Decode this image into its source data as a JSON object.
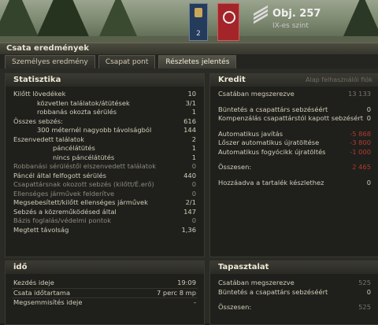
{
  "header": {
    "badge_blue_number": "2",
    "tank_name": "Obj. 257",
    "tank_tier": "IX-es szint"
  },
  "window": {
    "title": "Csata eredmények",
    "tabs": [
      "Személyes eredmény",
      "Csapat pont",
      "Részletes jelentés"
    ],
    "active_tab": 2
  },
  "stats": {
    "title": "Statisztika",
    "rows": [
      {
        "label": "Kilőtt lövedékek",
        "value": "10",
        "indent": 0
      },
      {
        "label": "közvetlen találatok/átütések",
        "value": "3/1",
        "indent": 1
      },
      {
        "label": "robbanás okozta sérülés",
        "value": "1",
        "indent": 1
      },
      {
        "label": "Összes sebzés:",
        "value": "616",
        "indent": 0
      },
      {
        "label": "300 méternél nagyobb távolságból",
        "value": "144",
        "indent": 1
      },
      {
        "label": "Eszenvedett találatok",
        "value": "2",
        "indent": 0
      },
      {
        "label": "páncélátütés",
        "value": "1",
        "indent": 2
      },
      {
        "label": "nincs páncélátütés",
        "value": "1",
        "indent": 2
      },
      {
        "label": "Robbanási sérüléstől elszenvedett találatok",
        "value": "0",
        "indent": 0,
        "dim": true
      },
      {
        "label": "Páncél által felfogott sérülés",
        "value": "440",
        "indent": 0
      },
      {
        "label": "Csapattársnak okozott sebzés (kilőtt/É.erő)",
        "value": "0",
        "indent": 0,
        "dim": true
      },
      {
        "label": "Ellenséges járművek felderítve",
        "value": "0",
        "indent": 0,
        "dim": true
      },
      {
        "label": "Megsebesített/kilőtt ellenséges járművek",
        "value": "2/1",
        "indent": 0
      },
      {
        "label": "Sebzés a közreműködésed által",
        "value": "147",
        "indent": 0
      },
      {
        "label": "Bázis foglalás/védelmi pontok",
        "value": "0",
        "indent": 0,
        "dim": true
      },
      {
        "label": "Megtett távolság",
        "value": "1,36",
        "indent": 0
      }
    ]
  },
  "kredit": {
    "title": "Kredit",
    "header_right": "Alap felhasználói fiók",
    "rows": [
      {
        "label": "Csatában megszerezve",
        "value": "13 133",
        "value_dim": true,
        "gap_after": true
      },
      {
        "label": "Büntetés a csapattárs sebzéséért",
        "value": "0"
      },
      {
        "label": "Kompenzálás csapattárstól kapott sebzésért",
        "value": "0",
        "gap_after": true
      },
      {
        "label": "Automatikus javítás",
        "value": "-5 868",
        "red": true
      },
      {
        "label": "Lőszer automatikus újratöltése",
        "value": "-3 800",
        "red": true
      },
      {
        "label": "Automatikus fogyócikk újratöltés",
        "value": "-1 000",
        "red": true,
        "gap_after": true
      },
      {
        "label": "Összesen:",
        "value": "2 465",
        "red": true,
        "gap_after": true
      },
      {
        "label": "Hozzáadva a tartalék készlethez",
        "value": "0"
      }
    ]
  },
  "time": {
    "title": "idő",
    "rows": [
      {
        "label": "Kezdés ideje",
        "value": "19:09"
      },
      {
        "label": "Csata időtartama",
        "value": "7 perc 8 mp"
      },
      {
        "label": "Megsemmisítés ideje",
        "value": "-"
      }
    ]
  },
  "exp": {
    "title": "Tapasztalat",
    "rows": [
      {
        "label": "Csatában megszerezve",
        "value": "525",
        "value_dim": true
      },
      {
        "label": "Büntetés a csapattárs sebzéséért",
        "value": "0",
        "gap_after": true
      },
      {
        "label": "Összesen:",
        "value": "525",
        "value_dim": true
      }
    ]
  },
  "colors": {
    "accent_red": "#b3392f",
    "panel": "#1f201c",
    "text": "#d4cdb9"
  }
}
